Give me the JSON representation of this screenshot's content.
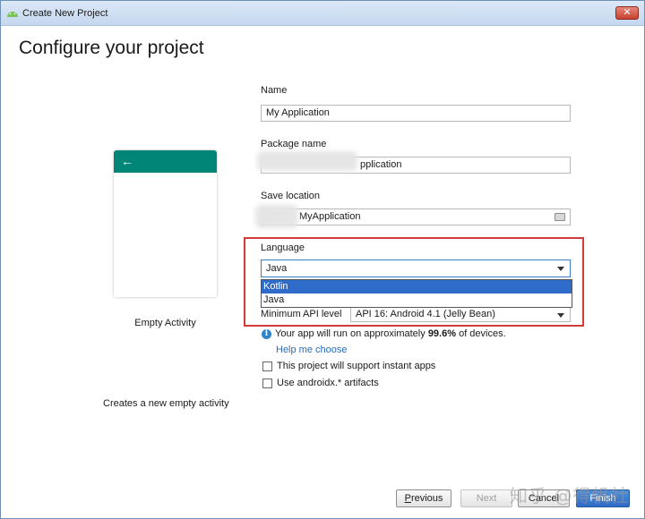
{
  "window": {
    "title": "Create New Project",
    "close_label": "✕"
  },
  "page": {
    "heading": "Configure your project"
  },
  "preview": {
    "back_arrow": "←",
    "activity_name": "Empty Activity",
    "activity_description": "Creates a new empty activity"
  },
  "form": {
    "name": {
      "label": "Name",
      "value": "My Application"
    },
    "package": {
      "label": "Package name",
      "value_visible": "pplication"
    },
    "save_location": {
      "label": "Save location",
      "value_visible": "MyApplication"
    },
    "language": {
      "label": "Language",
      "selected": "Java",
      "options": [
        "Kotlin",
        "Java"
      ],
      "highlighted_option": "Kotlin"
    },
    "min_api": {
      "label": "Minimum API level",
      "value": "API 16: Android 4.1 (Jelly Bean)"
    },
    "info": {
      "prefix": "Your app will run on approximately ",
      "percent": "99.6%",
      "suffix": " of devices."
    },
    "help_link": "Help me choose",
    "instant_apps": {
      "label": "This project will support instant apps",
      "checked": false
    },
    "androidx": {
      "label": "Use androidx.* artifacts",
      "checked": false
    }
  },
  "footer": {
    "previous": {
      "mnemonic": "P",
      "rest": "revious"
    },
    "next": "Next",
    "cancel": "Cancel",
    "finish": "Finish"
  },
  "watermark": "知乎 @得帆社",
  "colors": {
    "accent": "#008577",
    "highlight_border": "#d33a3a",
    "selection": "#2f6bc8"
  }
}
